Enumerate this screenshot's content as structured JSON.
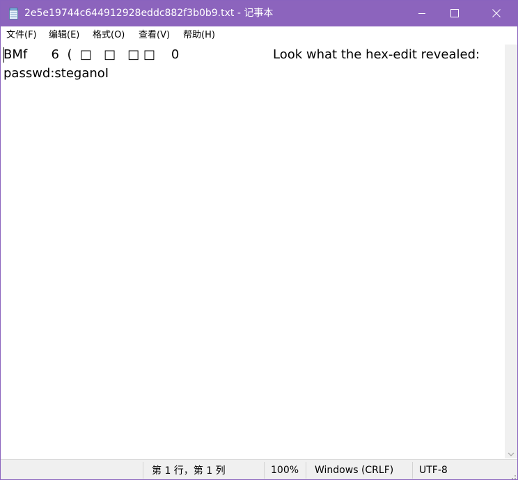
{
  "window": {
    "title": "2e5e19744c644912928eddc882f3b0b9.txt - 记事本",
    "accent": "#8c64bd"
  },
  "menu": {
    "file": "文件(F)",
    "edit": "编辑(E)",
    "format": "格式(O)",
    "view": "查看(V)",
    "help": "帮助(H)"
  },
  "document": {
    "line1_left": "BMf      6  (  □   □   □ □    0",
    "line1_right": "Look what the hex-edit revealed:",
    "line2": "passwd:steganoI"
  },
  "status": {
    "position": "第 1 行，第 1 列",
    "zoom": "100%",
    "line_ending": "Windows (CRLF)",
    "encoding": "UTF-8"
  },
  "icons": {
    "app": "notepad-icon",
    "minimize": "minimize-icon",
    "maximize": "maximize-icon",
    "close": "close-icon",
    "scroll_down": "scroll-down-arrow-icon"
  }
}
